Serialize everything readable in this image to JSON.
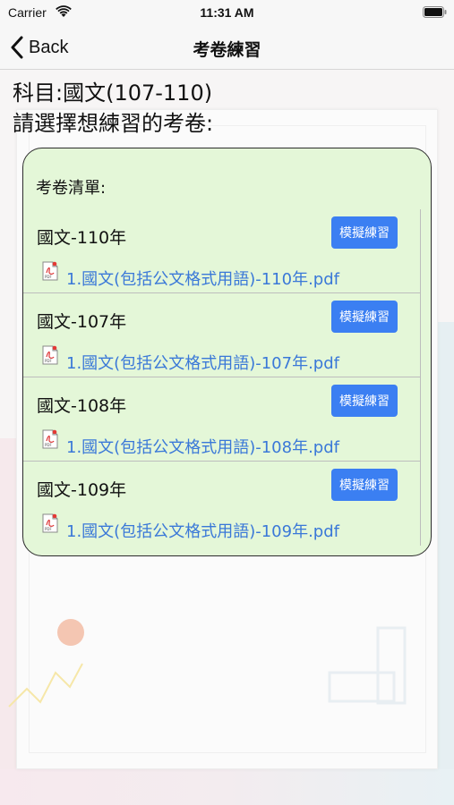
{
  "status_bar": {
    "carrier": "Carrier",
    "time": "11:31 AM",
    "wifi_icon": "wifi-icon",
    "battery_icon": "battery-icon"
  },
  "nav": {
    "back_label": "Back",
    "back_icon": "chevron-left-icon",
    "title": "考卷練習"
  },
  "header": {
    "subject": "科目:國文(107-110)",
    "instruction": "請選擇想練習的考卷:"
  },
  "panel": {
    "title": "考卷清單:",
    "exams": [
      {
        "name": "國文-110年",
        "button": "模擬練習",
        "file": "1.國文(包括公文格式用語)-110年.pdf",
        "file_icon": "pdf-icon"
      },
      {
        "name": "國文-107年",
        "button": "模擬練習",
        "file": "1.國文(包括公文格式用語)-107年.pdf",
        "file_icon": "pdf-icon"
      },
      {
        "name": "國文-108年",
        "button": "模擬練習",
        "file": "1.國文(包括公文格式用語)-108年.pdf",
        "file_icon": "pdf-icon"
      },
      {
        "name": "國文-109年",
        "button": "模擬練習",
        "file": "1.國文(包括公文格式用語)-109年.pdf",
        "file_icon": "pdf-icon"
      }
    ]
  },
  "colors": {
    "panel_bg": "#e4f7d8",
    "button_bg": "#3b7ff2",
    "link": "#3a78d8"
  }
}
